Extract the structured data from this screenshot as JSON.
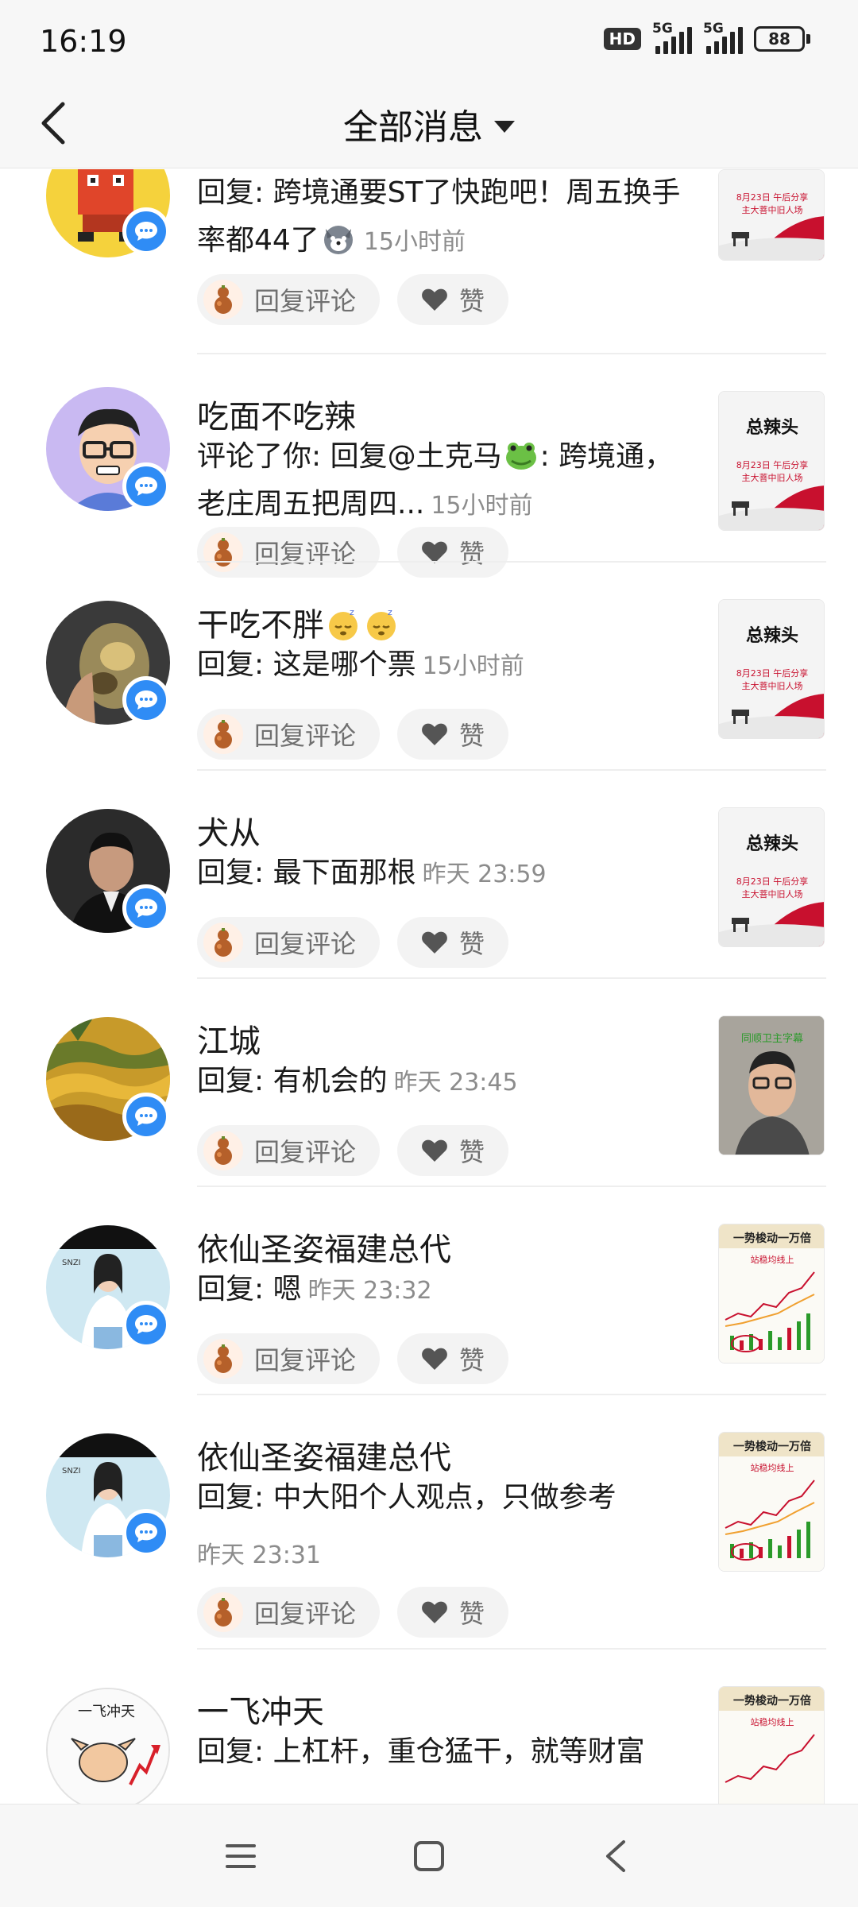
{
  "status_bar": {
    "time": "16:19",
    "hd": "HD",
    "net1": "5G",
    "net2": "5G",
    "battery": "88"
  },
  "header": {
    "title": "全部消息"
  },
  "actions": {
    "reply_label": "回复评论",
    "like_label": "赞"
  },
  "messages": [
    {
      "username": "",
      "content": "回复: 跨境通要ST了快跑吧！周五换手率都44了",
      "time": "15小时前"
    },
    {
      "username": "吃面不吃辣",
      "content_a": "评论了你: 回复@土克马",
      "content_b": ": 跨境通，老庄周五把周四...",
      "time": "15小时前"
    },
    {
      "username": "干吃不胖",
      "content": "回复: 这是哪个票",
      "time": "15小时前"
    },
    {
      "username": "犬从",
      "content": "回复: 最下面那根",
      "time": "昨天 23:59"
    },
    {
      "username": "江城",
      "content": "回复: 有机会的",
      "time": "昨天 23:45"
    },
    {
      "username": "依仙圣姿福建总代",
      "content": "回复: 嗯",
      "time": "昨天 23:32"
    },
    {
      "username": "依仙圣姿福建总代",
      "content": "回复: 中大阳个人观点，只做参考",
      "time": "昨天 23:31"
    },
    {
      "username": "一飞冲天",
      "content": "回复: 上杠杆，重仓猛干，就等财富"
    }
  ],
  "thumbs": {
    "title_text": "总辣头",
    "date_text": "8月23日 午后分享",
    "sub_text": "主大菩中旧人场",
    "video_caption": "同顺卫主字幕",
    "chart_text": "一势梭动一万倍",
    "chart_sub": "站稳均线上"
  },
  "avatar_texts": {
    "brand": "SNZI",
    "flying": "一飞冲天"
  },
  "colors": {
    "accent_blue": "#2f8cf5",
    "text_gray": "#8c8c8c"
  }
}
